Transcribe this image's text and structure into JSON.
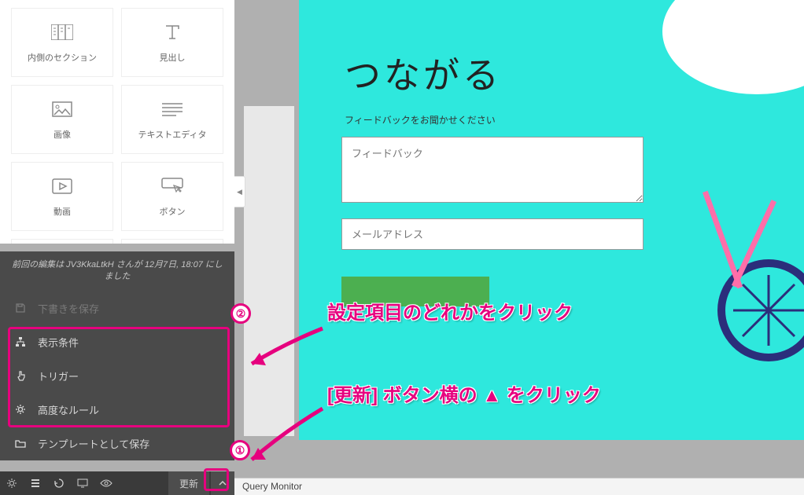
{
  "elements": {
    "inner_section": "内側のセクション",
    "heading": "見出し",
    "image": "画像",
    "text_editor": "テキストエディタ",
    "video": "動画",
    "button": "ボタン"
  },
  "status": "前回の編集は JV3KkaLtkH さんが 12月7日, 18:07 にしました",
  "menu": {
    "save_draft": "下書きを保存",
    "display_conditions": "表示条件",
    "trigger": "トリガー",
    "advanced_rules": "高度なルール",
    "save_template": "テンプレートとして保存"
  },
  "toolbar": {
    "update": "更新"
  },
  "badges": {
    "one": "①",
    "two": "②"
  },
  "annotations": {
    "click_setting": "設定項目のどれかをクリック",
    "click_caret": "[更新] ボタン横の ▲ をクリック"
  },
  "canvas": {
    "title": "つながる",
    "subtitle": "フィードバックをお聞かせください",
    "feedback_placeholder": "フィードバック",
    "email_placeholder": "メールアドレス"
  },
  "query_monitor": "Query Monitor"
}
